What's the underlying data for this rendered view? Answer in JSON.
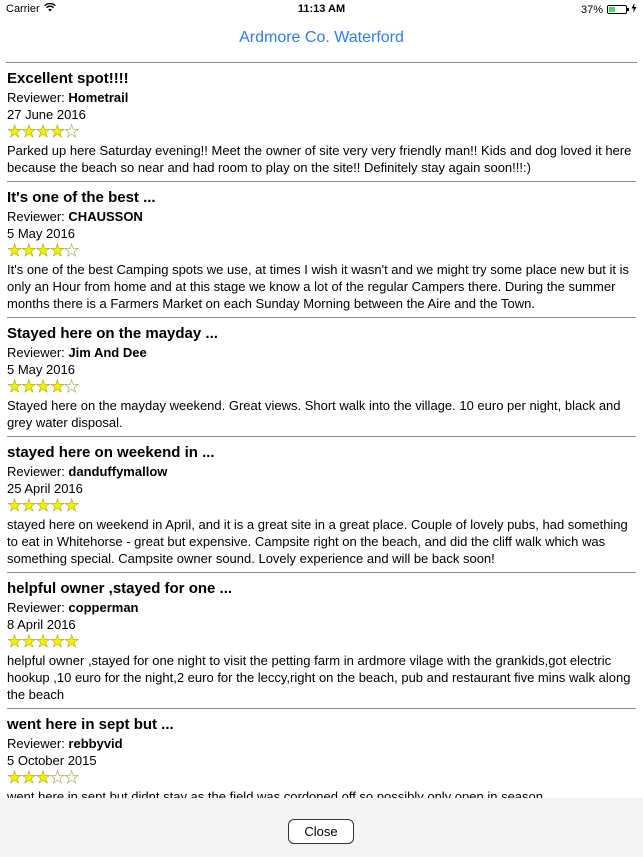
{
  "status_bar": {
    "carrier": "Carrier",
    "time": "11:13 AM",
    "battery": "37%",
    "battery_level": 0.37
  },
  "header": {
    "title": "Ardmore Co. Waterford"
  },
  "reviewer_prefix": "Reviewer: ",
  "reviews": [
    {
      "title": "Excellent spot!!!!",
      "reviewer": "Hometrail",
      "date": "27 June 2016",
      "rating": 4,
      "body": "Parked up here Saturday evening!! Meet the owner of site very very friendly man!! Kids and dog loved it here because the beach so near and had room to play on the site!! Definitely stay again soon!!!:)"
    },
    {
      "title": "It's one of the best ...",
      "reviewer": "CHAUSSON",
      "date": "5 May 2016",
      "rating": 4,
      "body": "It's one of the best Camping spots we use, at times I wish it wasn't and we might try some place new but it is only an Hour from home and at this stage we know a lot of the regular Campers there. During the summer months there is a Farmers Market on each Sunday Morning between the Aire and the Town."
    },
    {
      "title": "Stayed here on the mayday ...",
      "reviewer": "Jim And Dee",
      "date": "5 May 2016",
      "rating": 4,
      "body": "Stayed here on the mayday weekend. Great views. Short walk into the village. 10 euro per night, black and grey water disposal."
    },
    {
      "title": "stayed here on weekend in ...",
      "reviewer": "danduffymallow",
      "date": "25 April 2016",
      "rating": 5,
      "body": "stayed here on weekend in April, and it is a great site in a great place. Couple of lovely pubs, had something to eat in Whitehorse - great but expensive. Campsite right on the beach, and did the cliff walk which was something special. Campsite owner sound. Lovely experience and will be back soon!"
    },
    {
      "title": "helpful owner ,stayed for one ...",
      "reviewer": "copperman",
      "date": "8 April 2016",
      "rating": 5,
      "body": "helpful owner ,stayed for one night to visit the petting farm in ardmore vilage with the grankids,got electric hookup ,10 euro for the night,2 euro for the leccy,right on the beach, pub and restaurant five mins walk along the beach"
    },
    {
      "title": "went here in sept but ...",
      "reviewer": "rebbyvid",
      "date": "5 October 2015",
      "rating": 3,
      "body": "went here in sept but didnt stay as the field was cordoned off so possibly only open in season"
    }
  ],
  "footer": {
    "close_label": "Close"
  }
}
